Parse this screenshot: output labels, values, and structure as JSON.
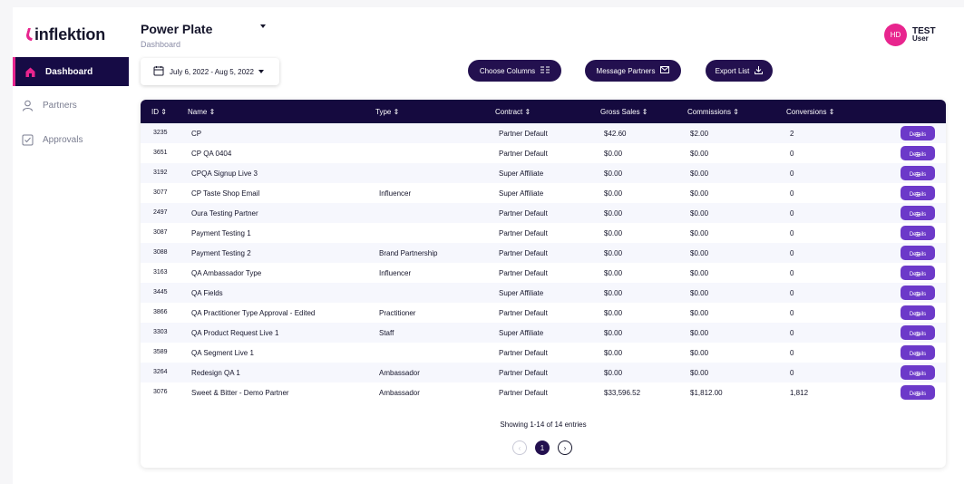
{
  "brand": {
    "logo_text": "inflektion",
    "accent": "#e8258e",
    "primary": "#23104f"
  },
  "sidebar": {
    "items": [
      {
        "label": "Dashboard",
        "icon": "home-icon",
        "active": true
      },
      {
        "label": "Partners",
        "icon": "user-icon",
        "active": false
      },
      {
        "label": "Approvals",
        "icon": "checkbox-icon",
        "active": false
      }
    ]
  },
  "header": {
    "title": "Power Plate",
    "subtitle": "Dashboard",
    "date_range": "July 6, 2022 - Aug 5, 2022",
    "choose_columns": "Choose Columns",
    "message_partners": "Message Partners",
    "export_list": "Export List"
  },
  "user": {
    "initials": "HD",
    "first": "TEST",
    "last": "User"
  },
  "table": {
    "columns": [
      "ID",
      "Name",
      "Type",
      "Contract",
      "Gross Sales",
      "Commissions",
      "Conversions"
    ],
    "details_label": "Details",
    "rows": [
      [
        "3235",
        "CP",
        "",
        "Partner Default",
        "$42.60",
        "$2.00",
        "2"
      ],
      [
        "3651",
        "CP QA 0404",
        "",
        "Partner Default",
        "$0.00",
        "$0.00",
        "0"
      ],
      [
        "3192",
        "CPQA Signup Live 3",
        "",
        "Super Affiliate",
        "$0.00",
        "$0.00",
        "0"
      ],
      [
        "3077",
        "CP Taste Shop Email",
        "Influencer",
        "Super Affiliate",
        "$0.00",
        "$0.00",
        "0"
      ],
      [
        "2497",
        "Oura Testing Partner",
        "",
        "Partner Default",
        "$0.00",
        "$0.00",
        "0"
      ],
      [
        "3087",
        "Payment Testing 1",
        "",
        "Partner Default",
        "$0.00",
        "$0.00",
        "0"
      ],
      [
        "3088",
        "Payment Testing 2",
        "Brand Partnership",
        "Partner Default",
        "$0.00",
        "$0.00",
        "0"
      ],
      [
        "3163",
        "QA Ambassador Type",
        "Influencer",
        "Partner Default",
        "$0.00",
        "$0.00",
        "0"
      ],
      [
        "3445",
        "QA Fields",
        "",
        "Super Affiliate",
        "$0.00",
        "$0.00",
        "0"
      ],
      [
        "3866",
        "QA Practitioner Type Approval - Edited",
        "Practitioner",
        "Partner Default",
        "$0.00",
        "$0.00",
        "0"
      ],
      [
        "3303",
        "QA Product Request Live 1",
        "Staff",
        "Super Affiliate",
        "$0.00",
        "$0.00",
        "0"
      ],
      [
        "3589",
        "QA Segment Live 1",
        "",
        "Partner Default",
        "$0.00",
        "$0.00",
        "0"
      ],
      [
        "3264",
        "Redesign QA 1",
        "Ambassador",
        "Partner Default",
        "$0.00",
        "$0.00",
        "0"
      ],
      [
        "3076",
        "Sweet & Bitter - Demo Partner",
        "Ambassador",
        "Partner Default",
        "$33,596.52",
        "$1,812.00",
        "1,812"
      ]
    ],
    "summary": "Showing 1-14 of 14 entries",
    "current_page": "1"
  }
}
